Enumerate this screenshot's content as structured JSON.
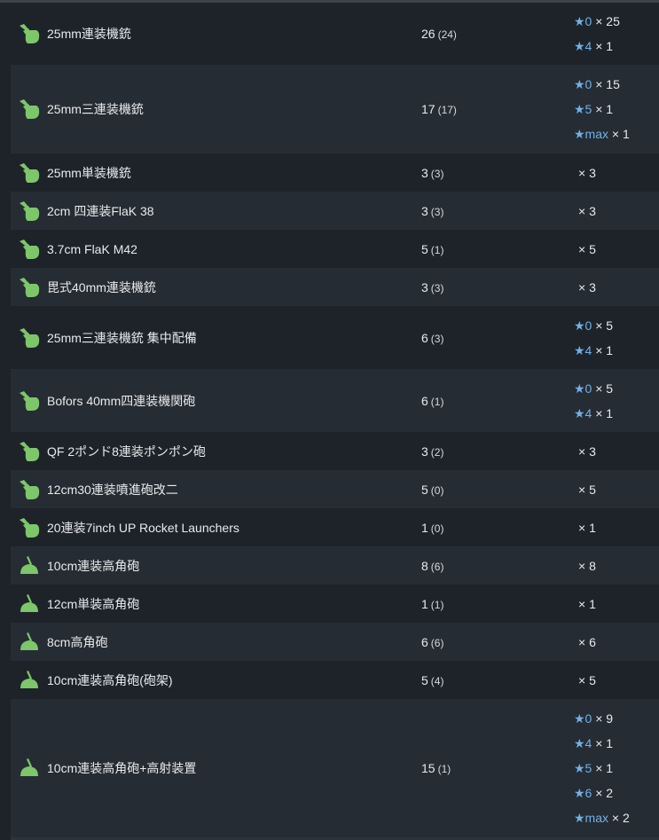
{
  "colors": {
    "star": "#6fb2ea",
    "icon_green": "#7dc66a",
    "row_dark": "#1e232a",
    "row_light": "#262c33"
  },
  "rows": [
    {
      "name": "25mm連装機銃",
      "count": "26",
      "sub": "(24)",
      "icon": "aa-gun-icon",
      "stars": [
        {
          "lvl": "★0",
          "mult": "× 25"
        },
        {
          "lvl": "★4",
          "mult": "× 1"
        }
      ]
    },
    {
      "name": "25mm三連装機銃",
      "count": "17",
      "sub": "(17)",
      "icon": "aa-gun-icon",
      "stars": [
        {
          "lvl": "★0",
          "mult": "× 15"
        },
        {
          "lvl": "★5",
          "mult": "× 1"
        },
        {
          "lvl": "★max",
          "mult": "× 1"
        }
      ]
    },
    {
      "name": "25mm単装機銃",
      "count": "3",
      "sub": "(3)",
      "icon": "aa-gun-icon",
      "plain": "× 3"
    },
    {
      "name": "2cm 四連装FlaK 38",
      "count": "3",
      "sub": "(3)",
      "icon": "aa-gun-icon",
      "plain": "× 3"
    },
    {
      "name": "3.7cm FlaK M42",
      "count": "5",
      "sub": "(1)",
      "icon": "aa-gun-icon",
      "plain": "× 5"
    },
    {
      "name": "毘式40mm連装機銃",
      "count": "3",
      "sub": "(3)",
      "icon": "aa-gun-icon",
      "plain": "× 3"
    },
    {
      "name": "25mm三連装機銃 集中配備",
      "count": "6",
      "sub": "(3)",
      "icon": "aa-gun-icon",
      "stars": [
        {
          "lvl": "★0",
          "mult": "× 5"
        },
        {
          "lvl": "★4",
          "mult": "× 1"
        }
      ]
    },
    {
      "name": "Bofors 40mm四連装機関砲",
      "count": "6",
      "sub": "(1)",
      "icon": "aa-gun-icon",
      "stars": [
        {
          "lvl": "★0",
          "mult": "× 5"
        },
        {
          "lvl": "★4",
          "mult": "× 1"
        }
      ]
    },
    {
      "name": "QF 2ポンド8連装ポンポン砲",
      "count": "3",
      "sub": "(2)",
      "icon": "aa-gun-icon",
      "plain": "× 3"
    },
    {
      "name": "12cm30連装噴進砲改二",
      "count": "5",
      "sub": "(0)",
      "icon": "aa-gun-icon",
      "plain": "× 5"
    },
    {
      "name": "20連装7inch UP Rocket Launchers",
      "count": "1",
      "sub": "(0)",
      "icon": "aa-gun-icon",
      "plain": "× 1"
    },
    {
      "name": "10cm連装高角砲",
      "count": "8",
      "sub": "(6)",
      "icon": "ha-gun-icon",
      "plain": "× 8"
    },
    {
      "name": "12cm単装高角砲",
      "count": "1",
      "sub": "(1)",
      "icon": "ha-gun-icon",
      "plain": "× 1"
    },
    {
      "name": "8cm高角砲",
      "count": "6",
      "sub": "(6)",
      "icon": "ha-gun-icon",
      "plain": "× 6"
    },
    {
      "name": "10cm連装高角砲(砲架)",
      "count": "5",
      "sub": "(4)",
      "icon": "ha-gun-icon",
      "plain": "× 5"
    },
    {
      "name": "10cm連装高角砲+高射装置",
      "count": "15",
      "sub": "(1)",
      "icon": "ha-gun-icon",
      "stars": [
        {
          "lvl": "★0",
          "mult": "× 9"
        },
        {
          "lvl": "★4",
          "mult": "× 1"
        },
        {
          "lvl": "★5",
          "mult": "× 1"
        },
        {
          "lvl": "★6",
          "mult": "× 2"
        },
        {
          "lvl": "★max",
          "mult": "× 2"
        }
      ]
    }
  ]
}
